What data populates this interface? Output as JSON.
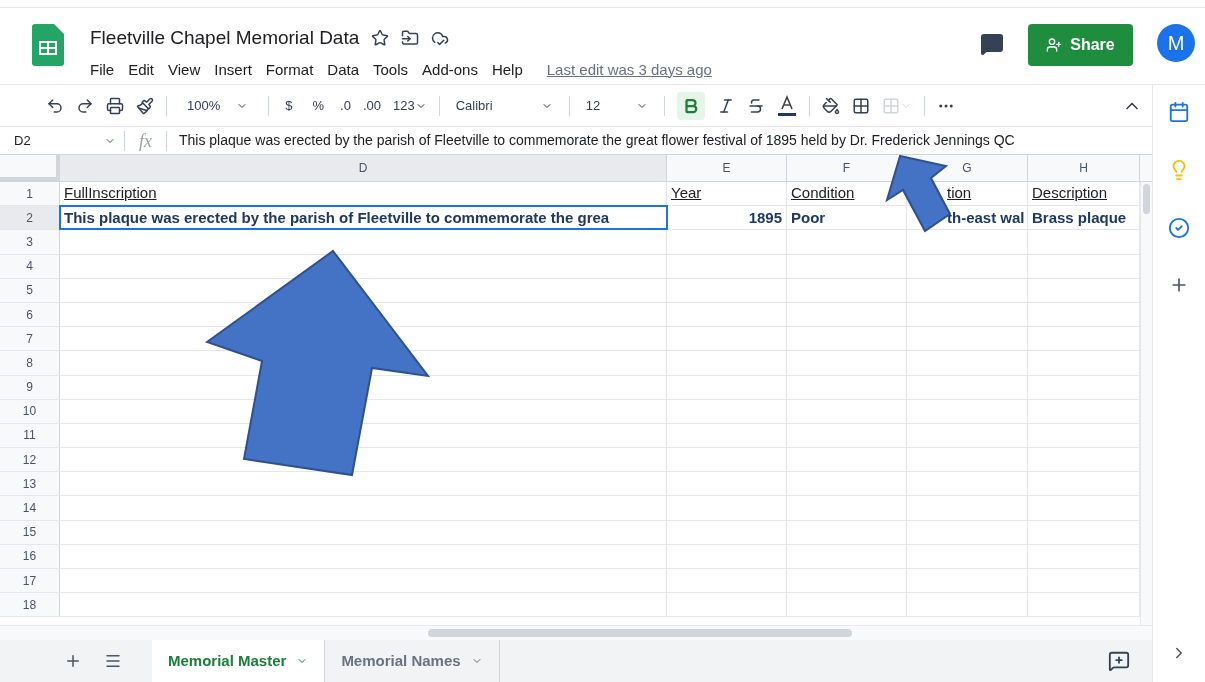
{
  "document": {
    "title": "Fleetville Chapel Memorial Data",
    "last_edit": "Last edit was 3 days ago",
    "share": "Share",
    "avatar": "M"
  },
  "menu": [
    "File",
    "Edit",
    "View",
    "Insert",
    "Format",
    "Data",
    "Tools",
    "Add-ons",
    "Help"
  ],
  "toolbar": {
    "zoom": "100%",
    "currency": "$",
    "percent": "%",
    "decrease_decimals": ".0",
    "increase_decimals": ".00",
    "number_format": "123",
    "font": "Calibri",
    "font_size": "12",
    "bold": {
      "selected": true
    }
  },
  "formula_bar": {
    "cell": "D2",
    "fx": "fx",
    "value": "This plaque was erected by the parish of Fleetville to commemorate the great flower festival of 1895 held by Dr. Frederick Jennings QC"
  },
  "grid": {
    "columns": [
      "D",
      "E",
      "F",
      "G",
      "H"
    ],
    "rows": [
      {
        "number": "1",
        "cells": [
          {
            "text": "FullInscription",
            "kind": "header"
          },
          {
            "text": "Year",
            "kind": "header"
          },
          {
            "text": "Condition",
            "kind": "header"
          },
          {
            "text": "tion",
            "kind": "header",
            "partial": true
          },
          {
            "text": "Description",
            "kind": "header"
          }
        ]
      },
      {
        "number": "2",
        "cells": [
          {
            "text": "This plaque was erected by the parish of Fleetville to commemorate the grea",
            "kind": "value",
            "selected": true
          },
          {
            "text": "1895",
            "kind": "number"
          },
          {
            "text": "Poor",
            "kind": "value"
          },
          {
            "text": "th-east wal",
            "kind": "value",
            "partial": true
          },
          {
            "text": "Brass plaque",
            "kind": "value"
          }
        ]
      },
      {
        "number": "3"
      },
      {
        "number": "4"
      },
      {
        "number": "5"
      },
      {
        "number": "6"
      },
      {
        "number": "7"
      },
      {
        "number": "8"
      },
      {
        "number": "9"
      },
      {
        "number": "10"
      },
      {
        "number": "11"
      },
      {
        "number": "12"
      },
      {
        "number": "13"
      },
      {
        "number": "14"
      },
      {
        "number": "15"
      },
      {
        "number": "16"
      },
      {
        "number": "17"
      },
      {
        "number": "18"
      }
    ]
  },
  "sheets": [
    {
      "label": "Memorial Master",
      "selected": true
    },
    {
      "label": "Memorial Names",
      "selected": false
    }
  ]
}
